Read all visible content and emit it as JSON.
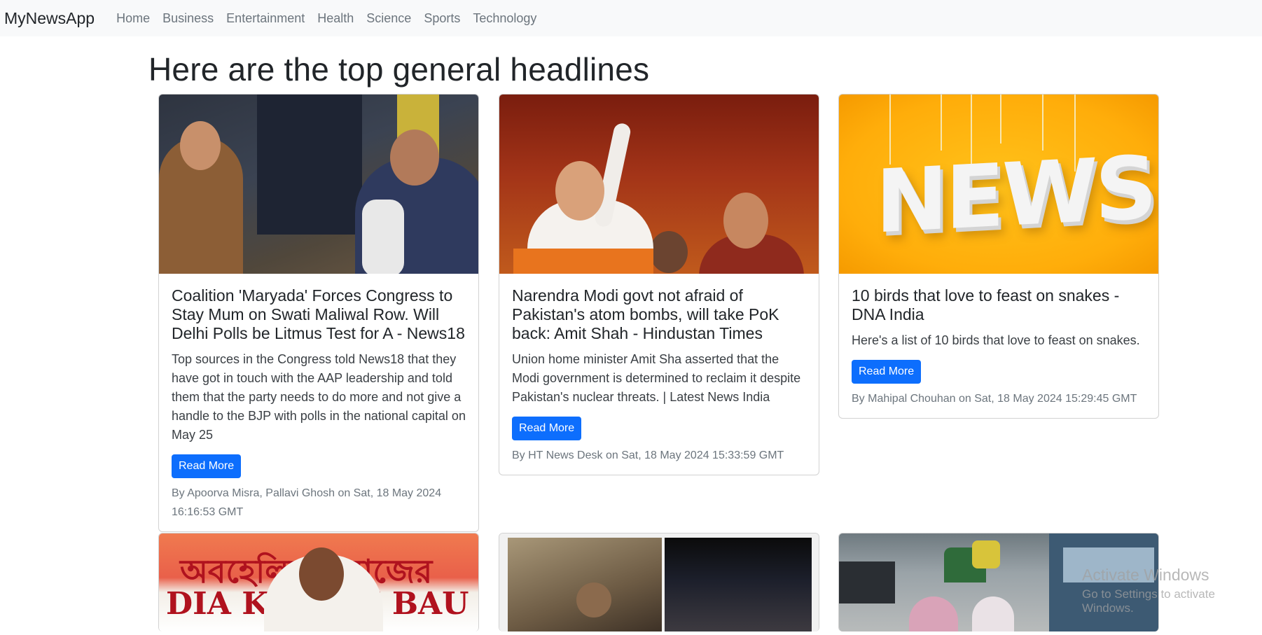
{
  "navbar": {
    "brand": "MyNewsApp",
    "items": [
      "Home",
      "Business",
      "Entertainment",
      "Health",
      "Science",
      "Sports",
      "Technology"
    ]
  },
  "page_title": "Here are the top general headlines",
  "cards": [
    {
      "title": "Coalition 'Maryada' Forces Congress to Stay Mum on Swati Maliwal Row. Will Delhi Polls be Litmus Test for A - News18",
      "description": "Top sources in the Congress told News18 that they have got in touch with the AAP leadership and told them that the party needs to do more and not give a handle to the BJP with polls in the national capital on May 25",
      "button": "Read More",
      "byline": "By Apoorva Misra, Pallavi Ghosh on Sat, 18 May 2024 16:16:53 GMT"
    },
    {
      "title": "Narendra Modi govt not afraid of Pakistan's atom bombs, will take PoK back: Amit Shah - Hindustan Times",
      "description": "Union home minister Amit Sha asserted that the Modi government is determined to reclaim it despite Pakistan's nuclear threats. | Latest News India",
      "button": "Read More",
      "byline": "By HT News Desk on Sat, 18 May 2024 15:33:59 GMT"
    },
    {
      "title": "10 birds that love to feast on snakes - DNA India",
      "description": "Here's a list of 10 birds that love to feast on snakes.",
      "button": "Read More",
      "byline": "By Mahipal Chouhan on Sat, 18 May 2024 15:29:45 GMT",
      "image_text": "NEWS"
    }
  ],
  "bottom_cards_image_text": {
    "banner_line1": "অবহেলিত সমাজের",
    "banner_line2": "DIA KIRTAN BAU"
  },
  "watermark": {
    "line1": "Activate Windows",
    "line2": "Go to Settings to activate Windows."
  }
}
